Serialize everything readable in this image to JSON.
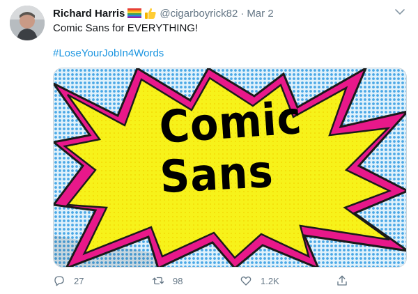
{
  "tweet": {
    "display_name": "Richard Harris",
    "emojis": [
      "rainbow-flag",
      "thumbs-up"
    ],
    "handle": "@cigarboyrick82",
    "separator": "·",
    "date": "Mar 2",
    "text": "Comic Sans for EVERYTHING!",
    "hashtag": "#LoseYourJobIn4Words"
  },
  "media": {
    "line1": "Comic",
    "line2": "Sans",
    "colors": {
      "burst_fill": "#f7f21a",
      "burst_outline": "#e8188a",
      "background_dots": "#4aa8e6",
      "text": "#000000"
    }
  },
  "actions": {
    "reply_count": "27",
    "retweet_count": "98",
    "like_count": "1.2K",
    "icons": [
      "reply-icon",
      "retweet-icon",
      "like-icon",
      "share-icon"
    ]
  },
  "colors": {
    "link": "#1b95e0",
    "muted": "#657786",
    "text": "#14171a"
  }
}
